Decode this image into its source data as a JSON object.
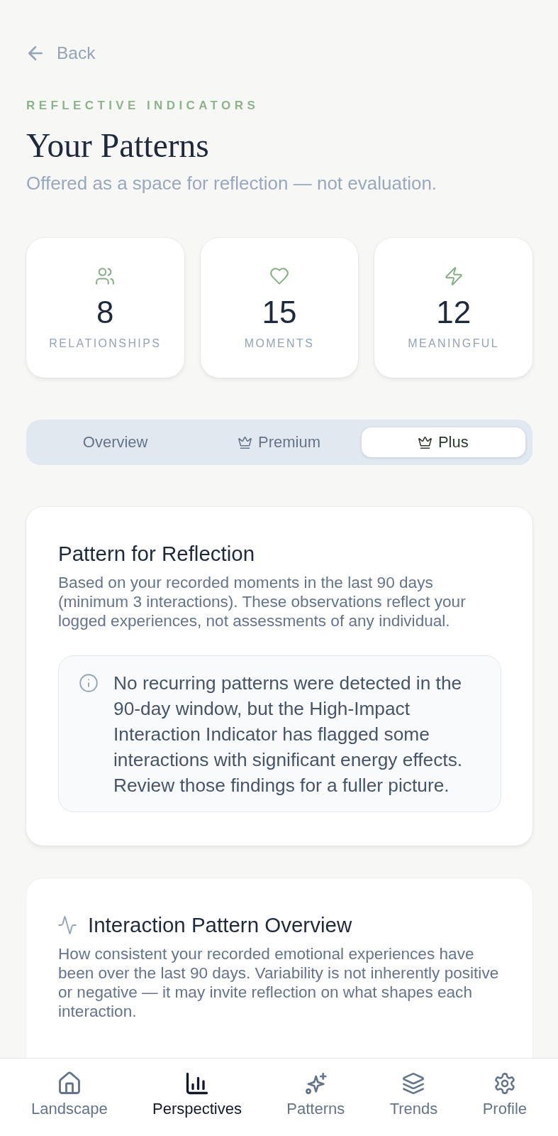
{
  "back": {
    "label": "Back"
  },
  "header": {
    "eyebrow": "REFLECTIVE INDICATORS",
    "title": "Your Patterns",
    "subtitle": "Offered as a space for reflection — not evaluation."
  },
  "stats": [
    {
      "value": "8",
      "label": "RELATIONSHIPS"
    },
    {
      "value": "15",
      "label": "MOMENTS"
    },
    {
      "value": "12",
      "label": "MEANINGFUL"
    }
  ],
  "tabs": [
    {
      "label": "Overview",
      "selected": false
    },
    {
      "label": "Premium",
      "selected": false
    },
    {
      "label": "Plus",
      "selected": true
    }
  ],
  "reflection_card": {
    "title": "Pattern for Reflection",
    "description": "Based on your recorded moments in the last 90 days (minimum 3 interactions). These observations reflect your logged experiences, not assessments of any individual.",
    "notice": "No recurring patterns were detected in the 90-day window, but the High-Impact Interaction Indicator has flagged some interactions with significant energy effects. Review those findings for a fuller picture."
  },
  "overview_card": {
    "title": "Interaction Pattern Overview",
    "description": "How consistent your recorded emotional experiences have been over the last 90 days. Variability is not inherently positive or negative — it may invite reflection on what shapes each interaction."
  },
  "bottom_nav": [
    {
      "label": "Landscape",
      "selected": false
    },
    {
      "label": "Perspectives",
      "selected": true
    },
    {
      "label": "Patterns",
      "selected": false
    },
    {
      "label": "Trends",
      "selected": false
    },
    {
      "label": "Profile",
      "selected": false
    }
  ]
}
